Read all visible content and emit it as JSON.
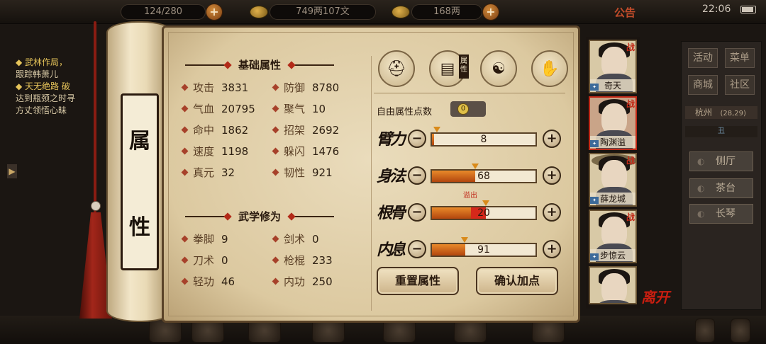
{
  "topbar": {
    "stamina_partial": "124/280",
    "money": "749两107文",
    "ingot": "168两",
    "announce": "公告",
    "clock": "22:06"
  },
  "left_quest": {
    "line1": "◆ 武林作局，",
    "line2": "跟踪韩萧儿",
    "line3": "◆ 天无绝路 破",
    "line4": "达到瓶颈之时寻",
    "line5": "方丈领悟心昧"
  },
  "side_menu": {
    "btn1": "活动",
    "btn2": "菜单",
    "btn3": "商城",
    "btn4": "社区",
    "location": "杭州",
    "coords": "(28,29)",
    "subtab": "丑",
    "rooms": [
      "侧厅",
      "茶台",
      "长琴"
    ]
  },
  "scroll": {
    "char1": "属",
    "char2": "性"
  },
  "basic": {
    "title": "基础属性",
    "stats": [
      {
        "label": "攻击",
        "value": "3831"
      },
      {
        "label": "防御",
        "value": "8780"
      },
      {
        "label": "气血",
        "value": "20795"
      },
      {
        "label": "聚气",
        "value": "10"
      },
      {
        "label": "命中",
        "value": "1862"
      },
      {
        "label": "招架",
        "value": "2692"
      },
      {
        "label": "速度",
        "value": "1198"
      },
      {
        "label": "躲闪",
        "value": "1476"
      },
      {
        "label": "真元",
        "value": "32"
      },
      {
        "label": "韧性",
        "value": "921"
      }
    ]
  },
  "martial": {
    "title": "武学修为",
    "stats": [
      {
        "label": "拳脚",
        "value": "9"
      },
      {
        "label": "剑术",
        "value": "0"
      },
      {
        "label": "刀术",
        "value": "0"
      },
      {
        "label": "枪棍",
        "value": "233"
      },
      {
        "label": "轻功",
        "value": "46"
      },
      {
        "label": "内功",
        "value": "250"
      }
    ]
  },
  "attrs": {
    "tab_tag": "属性",
    "free_points_label": "自由属性点数",
    "free_points_value": "0",
    "overflow_label": "溢出",
    "rows": [
      {
        "name": "臂力",
        "value": "8",
        "fill": 0.02,
        "over": 0
      },
      {
        "name": "身法",
        "value": "68",
        "fill": 0.42,
        "over": 0
      },
      {
        "name": "根骨",
        "value": "20",
        "fill": 0.38,
        "over": 0.14
      },
      {
        "name": "内息",
        "value": "91",
        "fill": 0.32,
        "over": 0
      }
    ],
    "reset_label": "重置属性",
    "confirm_label": "确认加点"
  },
  "roster": {
    "war_mark": "战",
    "heroes": [
      {
        "name": "奇天"
      },
      {
        "name": "陶渊溢"
      },
      {
        "name": "薛龙城"
      },
      {
        "name": "步惊云"
      },
      {
        "name": ""
      }
    ],
    "leave_label": "离开"
  }
}
